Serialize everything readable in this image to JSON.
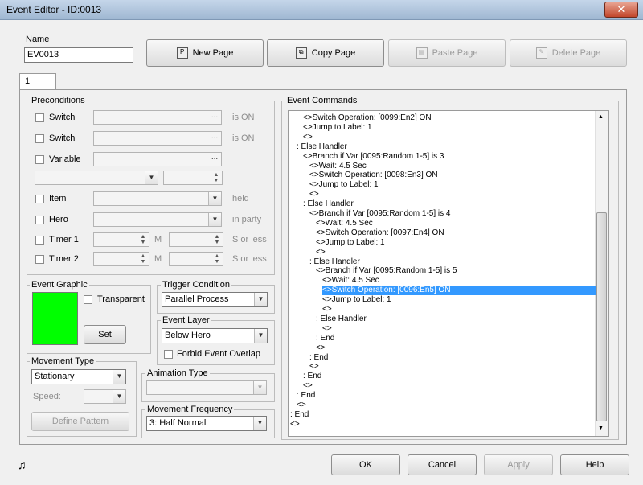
{
  "window": {
    "title": "Event Editor - ID:0013",
    "close_glyph": "✕"
  },
  "name": {
    "label": "Name",
    "value": "EV0013"
  },
  "toolbar": {
    "new_page": "New Page",
    "copy_page": "Copy Page",
    "paste_page": "Paste Page",
    "delete_page": "Delete Page"
  },
  "page_tab": "1",
  "preconditions": {
    "label": "Preconditions",
    "switch1": "Switch",
    "switch2": "Switch",
    "is_on1": "is ON",
    "is_on2": "is ON",
    "variable": "Variable",
    "item": "Item",
    "held": "held",
    "hero": "Hero",
    "in_party": "in party",
    "timer1": "Timer 1",
    "timer2": "Timer 2",
    "m1": "M",
    "m2": "M",
    "s_or_less1": "S or less",
    "s_or_less2": "S or less",
    "ellipsis": "..."
  },
  "event_graphic": {
    "label": "Event Graphic",
    "transparent": "Transparent",
    "set": "Set",
    "color": "#00ff00"
  },
  "trigger": {
    "label": "Trigger Condition",
    "value": "Parallel Process"
  },
  "layer": {
    "label": "Event Layer",
    "value": "Below Hero",
    "forbid": "Forbid Event Overlap"
  },
  "movement_type": {
    "label": "Movement Type",
    "value": "Stationary",
    "speed": "Speed:",
    "define_pattern": "Define Pattern"
  },
  "animation_type": {
    "label": "Animation Type",
    "value": ""
  },
  "movement_frequency": {
    "label": "Movement Frequency",
    "value": "3: Half Normal"
  },
  "event_commands": {
    "label": "Event Commands",
    "lines": [
      {
        "indent": 2,
        "text": "<>Switch Operation: [0099:En2] ON"
      },
      {
        "indent": 2,
        "text": "<>Jump to Label: 1"
      },
      {
        "indent": 2,
        "text": "<>"
      },
      {
        "indent": 1,
        "text": ": Else Handler"
      },
      {
        "indent": 2,
        "text": "<>Branch if Var [0095:Random 1-5] is 3"
      },
      {
        "indent": 3,
        "text": "<>Wait: 4.5 Sec"
      },
      {
        "indent": 3,
        "text": "<>Switch Operation: [0098:En3] ON"
      },
      {
        "indent": 3,
        "text": "<>Jump to Label: 1"
      },
      {
        "indent": 3,
        "text": "<>"
      },
      {
        "indent": 2,
        "text": ": Else Handler"
      },
      {
        "indent": 3,
        "text": "<>Branch if Var [0095:Random 1-5] is 4"
      },
      {
        "indent": 4,
        "text": "<>Wait: 4.5 Sec"
      },
      {
        "indent": 4,
        "text": "<>Switch Operation: [0097:En4] ON"
      },
      {
        "indent": 4,
        "text": "<>Jump to Label: 1"
      },
      {
        "indent": 4,
        "text": "<>"
      },
      {
        "indent": 3,
        "text": ": Else Handler"
      },
      {
        "indent": 4,
        "text": "<>Branch if Var [0095:Random 1-5] is 5"
      },
      {
        "indent": 5,
        "text": "<>Wait: 4.5 Sec"
      },
      {
        "indent": 5,
        "text": "<>Switch Operation: [0096:En5] ON",
        "selected": true
      },
      {
        "indent": 5,
        "text": "<>Jump to Label: 1"
      },
      {
        "indent": 5,
        "text": "<>"
      },
      {
        "indent": 4,
        "text": ": Else Handler"
      },
      {
        "indent": 5,
        "text": "<>"
      },
      {
        "indent": 4,
        "text": ": End"
      },
      {
        "indent": 4,
        "text": "<>"
      },
      {
        "indent": 3,
        "text": ": End"
      },
      {
        "indent": 3,
        "text": "<>"
      },
      {
        "indent": 2,
        "text": ": End"
      },
      {
        "indent": 2,
        "text": "<>"
      },
      {
        "indent": 1,
        "text": ": End"
      },
      {
        "indent": 1,
        "text": "<>"
      },
      {
        "indent": 0,
        "text": ": End"
      },
      {
        "indent": 0,
        "text": "<>"
      }
    ]
  },
  "footer": {
    "ok": "OK",
    "cancel": "Cancel",
    "apply": "Apply",
    "help": "Help",
    "music_icon": "music-note-icon"
  }
}
